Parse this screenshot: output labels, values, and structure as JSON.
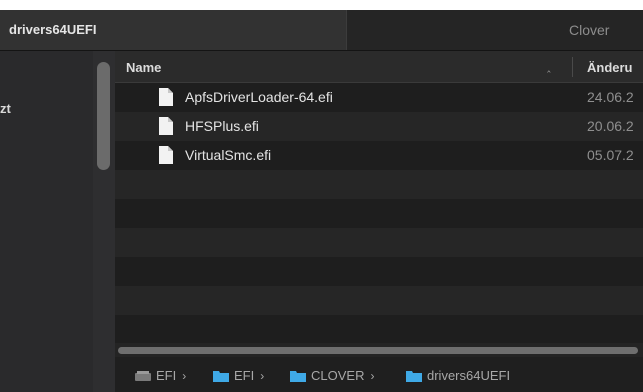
{
  "tabs": {
    "active": "drivers64UEFI",
    "inactive": "Clover"
  },
  "sidebar": {
    "items": [
      {
        "label": "zt"
      }
    ]
  },
  "header": {
    "name": "Name",
    "sort_indicator": "^",
    "date": "Änderu"
  },
  "files": [
    {
      "name": "ApfsDriverLoader-64.efi",
      "date": "24.06.2"
    },
    {
      "name": "HFSPlus.efi",
      "date": "20.06.2"
    },
    {
      "name": "VirtualSmc.efi",
      "date": "05.07.2"
    }
  ],
  "path": [
    {
      "label": "EFI",
      "icon": "disk-icon"
    },
    {
      "label": "EFI",
      "icon": "folder-icon"
    },
    {
      "label": "CLOVER",
      "icon": "folder-icon"
    },
    {
      "label": "drivers64UEFI",
      "icon": "folder-icon"
    }
  ],
  "path_separator": "›",
  "colors": {
    "folder": "#3fa9e6",
    "background": "#1e1e1e"
  }
}
